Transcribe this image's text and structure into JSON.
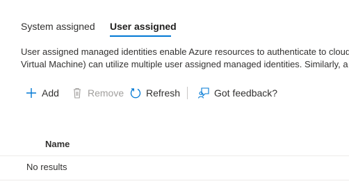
{
  "tabs": [
    {
      "label": "System assigned",
      "selected": false
    },
    {
      "label": "User assigned",
      "selected": true
    }
  ],
  "description": {
    "line1": "User assigned managed identities enable Azure resources to authenticate to cloud",
    "line2": "Virtual Machine) can utilize multiple user assigned managed identities. Similarly, a s"
  },
  "toolbar": {
    "add_label": "Add",
    "remove_label": "Remove",
    "refresh_label": "Refresh",
    "feedback_label": "Got feedback?"
  },
  "grid": {
    "columns": [
      "Name"
    ],
    "empty_text": "No results"
  },
  "colors": {
    "accent": "#0078d4",
    "text": "#323130",
    "disabled": "#a19f9d",
    "divider": "#edebe9"
  },
  "icons": {
    "add": "plus-icon",
    "remove": "trash-icon",
    "refresh": "refresh-icon",
    "feedback": "feedback-icon"
  }
}
